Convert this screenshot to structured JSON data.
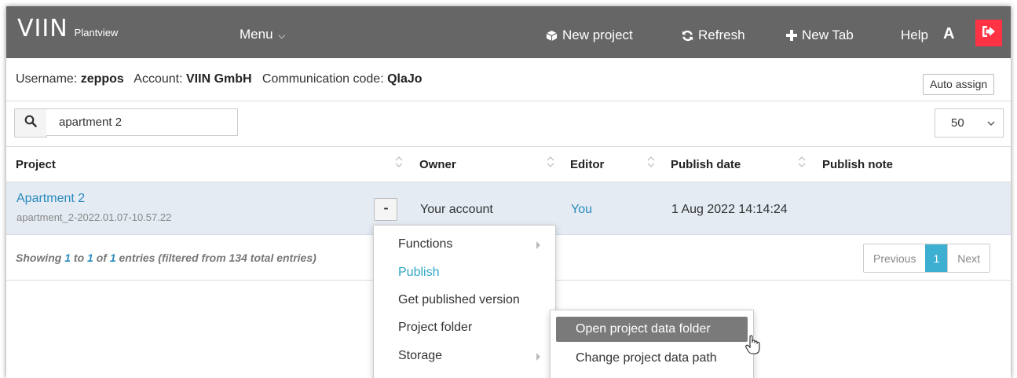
{
  "header": {
    "logo": "VIIN",
    "app_name": "Plantview",
    "menu_label": "Menu",
    "new_project": "New project",
    "refresh": "Refresh",
    "new_tab": "New Tab",
    "help": "Help",
    "user_initial": "A",
    "logout_color": "#ff3344"
  },
  "info": {
    "username_label": "Username:",
    "username": "zeppos",
    "account_label": "Account:",
    "account": "VIIN GmbH",
    "comm_label": "Communication code:",
    "comm_code": "QlaJo",
    "auto_assign": "Auto assign"
  },
  "search": {
    "value": "apartment 2",
    "page_size": "50"
  },
  "table": {
    "headers": {
      "project": "Project",
      "owner": "Owner",
      "editor": "Editor",
      "publish_date": "Publish date",
      "publish_note": "Publish note"
    },
    "rows": [
      {
        "name": "Apartment 2",
        "file": "apartment_2-2022.01.07-10.57.22",
        "actions": "•••",
        "owner": "Your account",
        "editor": "You",
        "publish_date": "1 Aug 2022 14:14:24",
        "publish_note": ""
      }
    ]
  },
  "footer": {
    "showing_prefix": "Showing",
    "from": "1",
    "to_label": "to",
    "to": "1",
    "of_label": "of",
    "total": "1",
    "entries_suffix": "entries (filtered from 134 total entries)",
    "previous": "Previous",
    "current_page": "1",
    "next": "Next"
  },
  "context_menu": {
    "items": [
      "Functions",
      "Publish",
      "Get published version",
      "Project folder",
      "Storage"
    ],
    "active": "Publish"
  },
  "submenu": {
    "items": [
      "Open project data folder",
      "Change project data path"
    ],
    "highlighted": "Open project data folder"
  },
  "colors": {
    "header_bg": "#666666",
    "link": "#2a8bbd",
    "row_selected": "#e4ebf3",
    "pager_active": "#3db0d1"
  }
}
